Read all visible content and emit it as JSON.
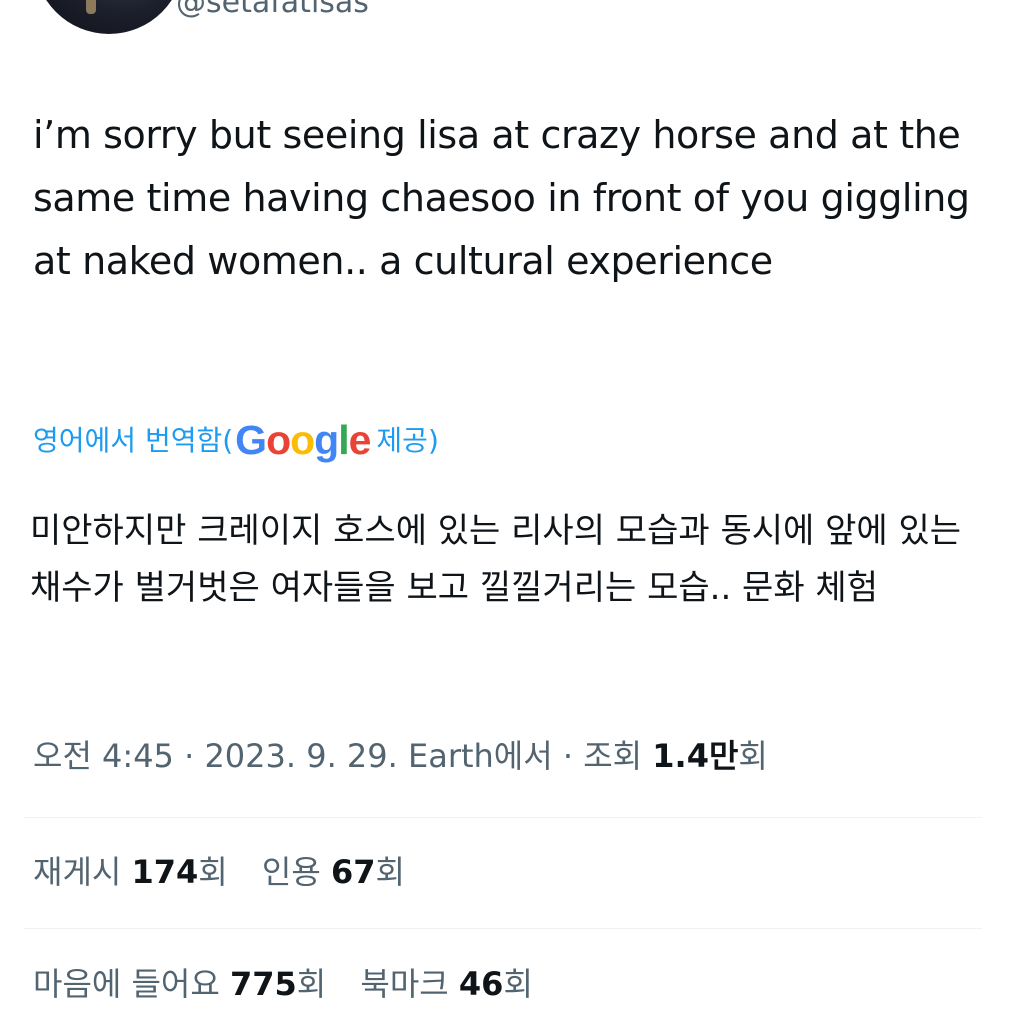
{
  "author": {
    "handle": "@setafatisas"
  },
  "tweet": {
    "text": "i’m sorry but seeing lisa at crazy horse and at the same time having chaesoo in front of you giggling at naked women.. a cultural experience"
  },
  "translation": {
    "label_prefix": "영어에서 번역함(",
    "provider_letters": [
      "G",
      "o",
      "o",
      "g",
      "l",
      "e"
    ],
    "label_suffix": " 제공)",
    "text": "미안하지만 크레이지 호스에 있는 리사의 모습과 동시에 앞에 있는 채수가 벌거벗은 여자들을 보고 낄낄거리는 모습.. 문화 체험"
  },
  "meta": {
    "time": "오전 4:45",
    "separator": " · ",
    "date": "2023. 9. 29.",
    "source": "Earth에서",
    "views_label": "조회 ",
    "views_value": "1.4만",
    "views_unit": "회"
  },
  "stats": {
    "reposts_label": "재게시 ",
    "reposts_value": "174",
    "reposts_unit": "회",
    "quotes_label": "인용 ",
    "quotes_value": "67",
    "quotes_unit": "회",
    "likes_label": "마음에 들어요 ",
    "likes_value": "775",
    "likes_unit": "회",
    "bookmarks_label": "북마크 ",
    "bookmarks_value": "46",
    "bookmarks_unit": "회"
  },
  "colors": {
    "text_primary": "#0f1419",
    "text_secondary": "#536471",
    "link_blue": "#1d9bf0",
    "divider": "#eff3f4",
    "google_blue": "#4285f4",
    "google_red": "#ea4335",
    "google_yellow": "#fbbc05",
    "google_green": "#34a853"
  }
}
